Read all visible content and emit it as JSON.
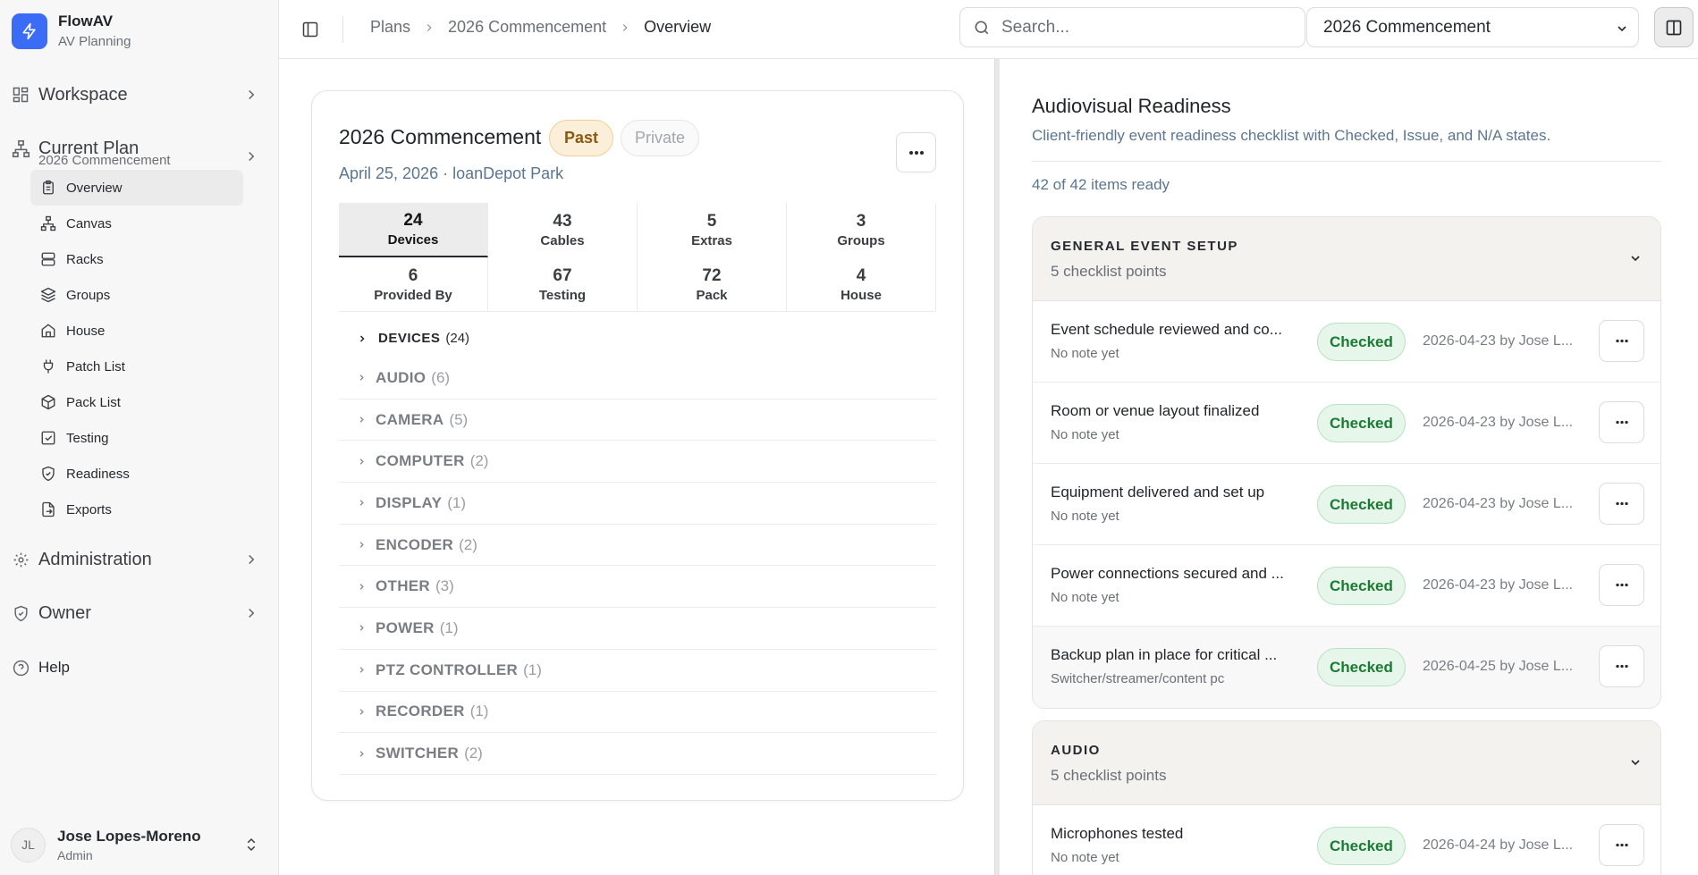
{
  "brand": {
    "name": "FlowAV",
    "subtitle": "AV Planning"
  },
  "sidebar": {
    "workspace_label": "Workspace",
    "current_plan_label": "Current Plan",
    "current_plan_name": "2026 Commencement",
    "items": [
      {
        "label": "Overview",
        "icon": "clipboard-icon",
        "active": true
      },
      {
        "label": "Canvas",
        "icon": "network-icon"
      },
      {
        "label": "Racks",
        "icon": "server-icon"
      },
      {
        "label": "Groups",
        "icon": "layers-icon"
      },
      {
        "label": "House",
        "icon": "home-icon"
      },
      {
        "label": "Patch List",
        "icon": "plug-icon"
      },
      {
        "label": "Pack List",
        "icon": "package-icon"
      },
      {
        "label": "Testing",
        "icon": "checkbox-icon"
      },
      {
        "label": "Readiness",
        "icon": "shield-check-icon"
      },
      {
        "label": "Exports",
        "icon": "export-icon"
      }
    ],
    "administration_label": "Administration",
    "owner_label": "Owner",
    "help_label": "Help"
  },
  "user": {
    "initials": "JL",
    "name": "Jose Lopes-Moreno",
    "role": "Admin"
  },
  "topbar": {
    "breadcrumb": [
      "Plans",
      "2026 Commencement",
      "Overview"
    ],
    "search_placeholder": "Search...",
    "plan_select_value": "2026 Commencement"
  },
  "plan": {
    "title": "2026 Commencement",
    "status_badge": "Past",
    "visibility_badge": "Private",
    "meta": "April 25, 2026 · loanDepot Park",
    "stats": [
      {
        "value": "24",
        "label": "Devices",
        "active": true
      },
      {
        "value": "43",
        "label": "Cables"
      },
      {
        "value": "5",
        "label": "Extras"
      },
      {
        "value": "3",
        "label": "Groups"
      },
      {
        "value": "6",
        "label": "Provided By"
      },
      {
        "value": "67",
        "label": "Testing"
      },
      {
        "value": "72",
        "label": "Pack"
      },
      {
        "value": "4",
        "label": "House"
      }
    ],
    "devices_heading": "DEVICES",
    "devices_count": "(24)",
    "categories": [
      {
        "label": "AUDIO",
        "count": "(6)"
      },
      {
        "label": "CAMERA",
        "count": "(5)"
      },
      {
        "label": "COMPUTER",
        "count": "(2)"
      },
      {
        "label": "DISPLAY",
        "count": "(1)"
      },
      {
        "label": "ENCODER",
        "count": "(2)"
      },
      {
        "label": "OTHER",
        "count": "(3)"
      },
      {
        "label": "POWER",
        "count": "(1)"
      },
      {
        "label": "PTZ CONTROLLER",
        "count": "(1)"
      },
      {
        "label": "RECORDER",
        "count": "(1)"
      },
      {
        "label": "SWITCHER",
        "count": "(2)"
      }
    ]
  },
  "readiness": {
    "title": "Audiovisual Readiness",
    "subtitle": "Client-friendly event readiness checklist with Checked, Issue, and N/A states.",
    "count_text": "42 of 42 items ready",
    "sections": [
      {
        "title": "GENERAL EVENT SETUP",
        "count": "5 checklist points",
        "items": [
          {
            "title": "Event schedule reviewed and co...",
            "note": "No note yet",
            "status": "Checked",
            "by": "2026-04-23 by Jose L..."
          },
          {
            "title": "Room or venue layout finalized",
            "note": "No note yet",
            "status": "Checked",
            "by": "2026-04-23 by Jose L..."
          },
          {
            "title": "Equipment delivered and set up",
            "note": "No note yet",
            "status": "Checked",
            "by": "2026-04-23 by Jose L..."
          },
          {
            "title": "Power connections secured and ...",
            "note": "No note yet",
            "status": "Checked",
            "by": "2026-04-23 by Jose L..."
          },
          {
            "title": "Backup plan in place for critical ...",
            "note": "Switcher/streamer/content pc",
            "status": "Checked",
            "by": "2026-04-25 by Jose L..."
          }
        ]
      },
      {
        "title": "AUDIO",
        "count": "5 checklist points",
        "items": [
          {
            "title": "Microphones tested",
            "note": "No note yet",
            "status": "Checked",
            "by": "2026-04-24 by Jose L..."
          }
        ]
      }
    ]
  },
  "colors": {
    "accent": "#3b6cf6",
    "checked_bg": "#e7f6ea",
    "checked_text": "#1b7a34",
    "past_bg": "#fbefd9"
  }
}
